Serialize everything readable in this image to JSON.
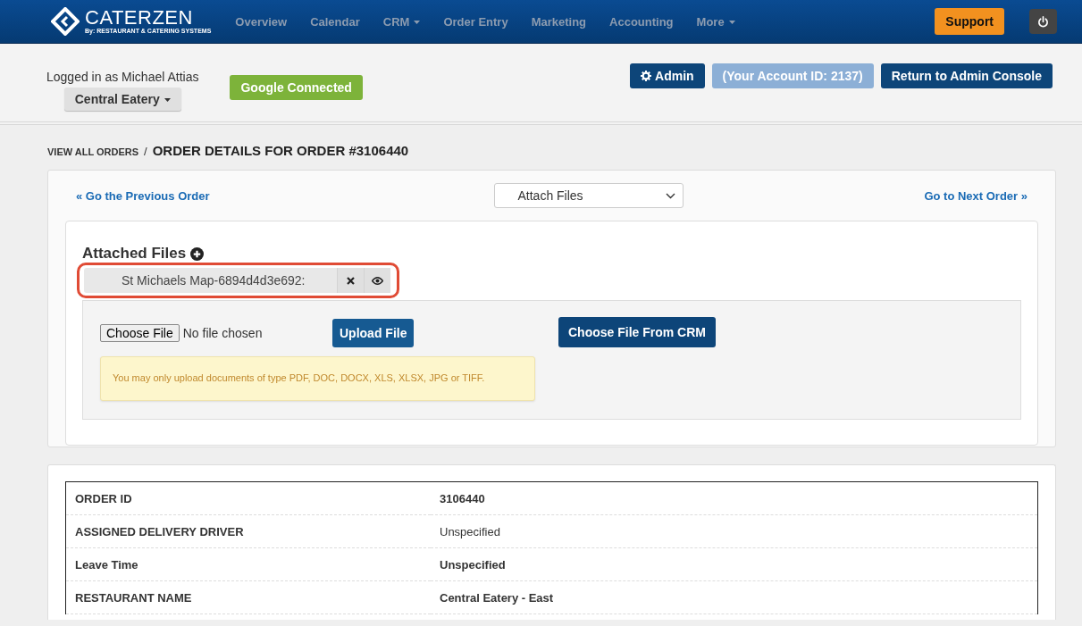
{
  "brand": {
    "name": "CATERZEN",
    "tagline": "By: RESTAURANT & CATERING SYSTEMS"
  },
  "nav": [
    {
      "label": "Overview",
      "dropdown": false
    },
    {
      "label": "Calendar",
      "dropdown": false
    },
    {
      "label": "CRM",
      "dropdown": true
    },
    {
      "label": "Order Entry",
      "dropdown": false
    },
    {
      "label": "Marketing",
      "dropdown": false
    },
    {
      "label": "Accounting",
      "dropdown": false
    },
    {
      "label": "More",
      "dropdown": true
    }
  ],
  "support": "Support",
  "account": {
    "logged_in": "Logged in as Michael Attias",
    "location": "Central Eatery",
    "google": "Google Connected",
    "admin": "Admin",
    "account_id": "(Your Account ID: 2137)",
    "return": "Return to Admin Console"
  },
  "breadcrumb": {
    "parent": "VIEW ALL ORDERS",
    "separator": "/",
    "current": "ORDER DETAILS FOR ORDER #3106440"
  },
  "order_nav": {
    "previous": "« Go the Previous Order",
    "action": "Attach Files",
    "next": "Go to Next Order »"
  },
  "attachments": {
    "title": "Attached Files",
    "files": [
      {
        "name": "St Michaels Map-6894d4d3e692:",
        "highlighted": true
      }
    ],
    "choose": "Choose File",
    "no_file": "No file chosen",
    "upload": "Upload File",
    "crm": "Choose File From CRM",
    "notice": "You may only upload documents of type PDF, DOC, DOCX, XLS, XLSX, JPG or TIFF."
  },
  "details": [
    {
      "label": "ORDER ID",
      "value": "3106440",
      "bold": true
    },
    {
      "label": "ASSIGNED DELIVERY DRIVER",
      "value": "Unspecified",
      "bold": false
    },
    {
      "label": "Leave Time",
      "value": "Unspecified",
      "bold": true
    },
    {
      "label": "RESTAURANT NAME",
      "value": "Central Eatery - East",
      "bold": true
    }
  ]
}
